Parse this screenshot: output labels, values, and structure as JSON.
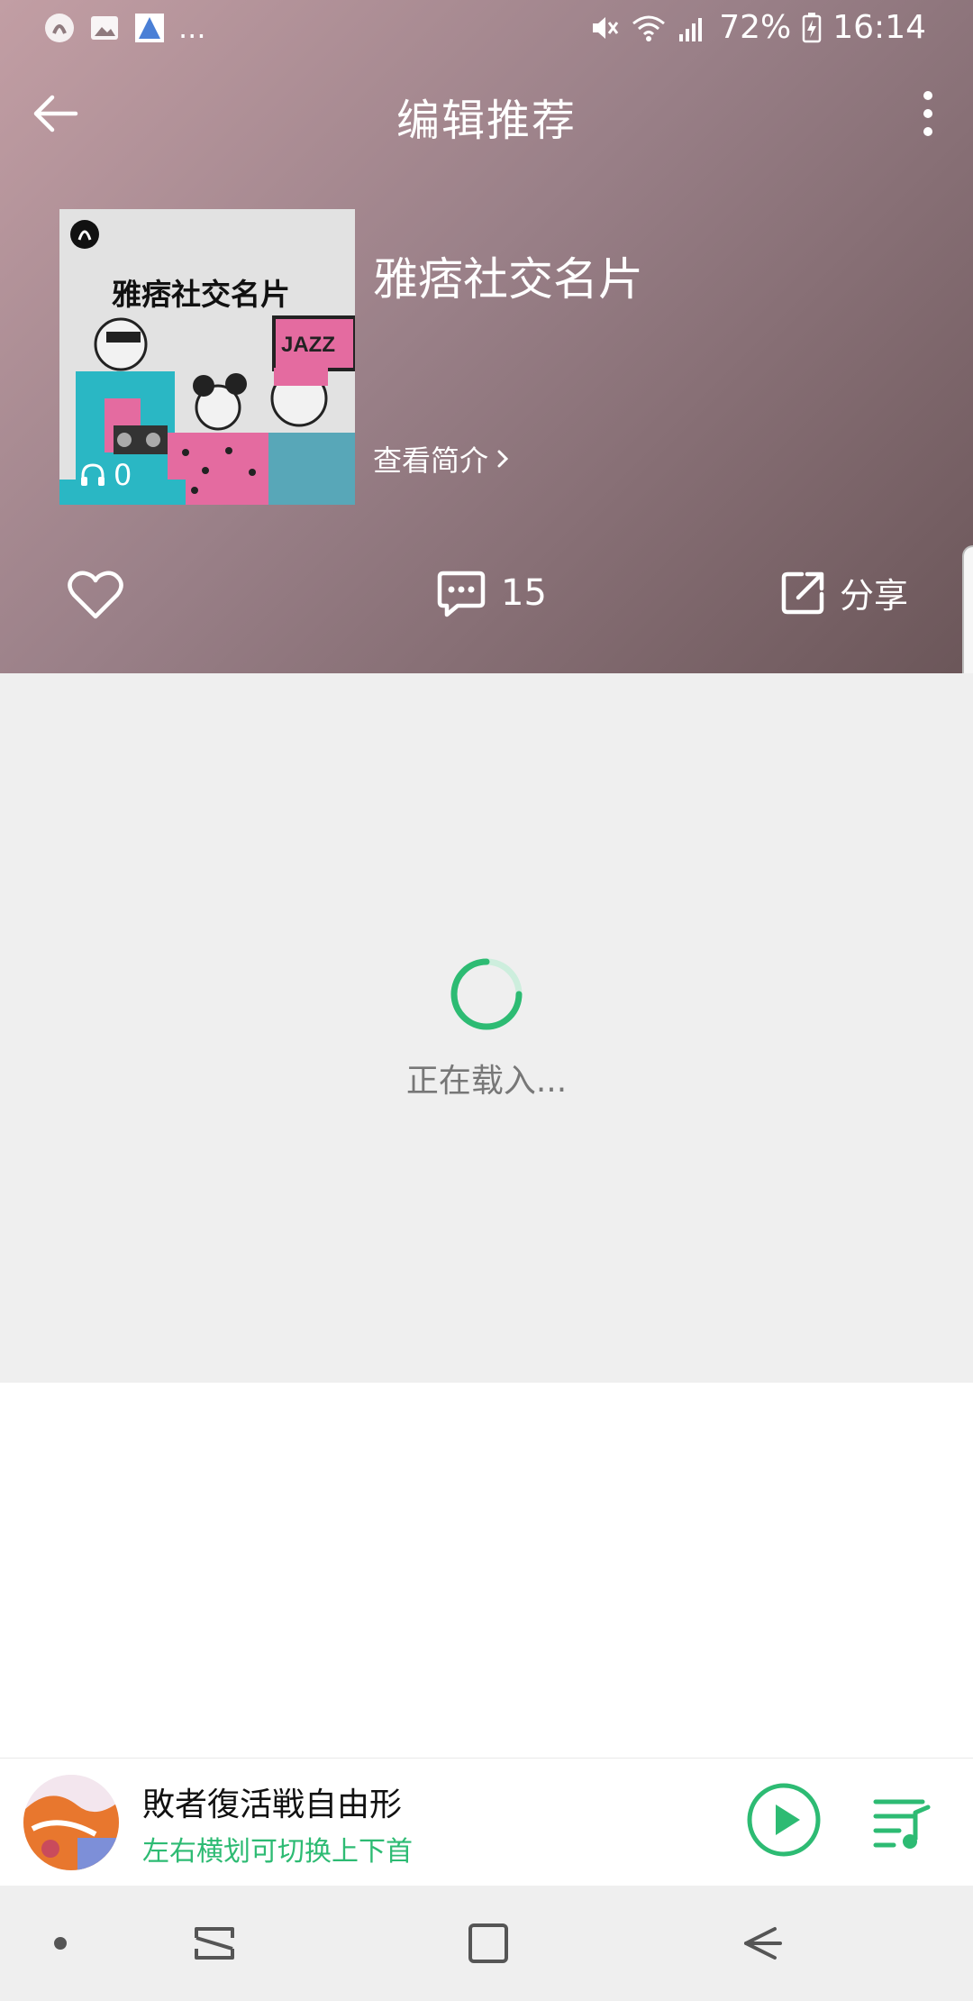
{
  "status_bar": {
    "battery": "72%",
    "time": "16:14",
    "overflow": "...",
    "icons": [
      "notification-icon",
      "gallery-icon",
      "app-icon",
      "mute-icon",
      "wifi-icon",
      "signal-icon",
      "battery-charging-icon"
    ]
  },
  "app_bar": {
    "title": "编辑推荐"
  },
  "playlist": {
    "cover_text": "雅痞社交名片",
    "cover_sign": "JAZZ",
    "play_count": "0",
    "title": "雅痞社交名片",
    "view_intro": "查看简介"
  },
  "actions": {
    "comment_count": "15",
    "share_label": "分享"
  },
  "loading": {
    "text": "正在载入..."
  },
  "player": {
    "song": "敗者復活戦自由形",
    "hint": "左右横划可切换上下首"
  },
  "colors": {
    "accent": "#2dbb73",
    "header_start": "#c29ea4",
    "header_end": "#6b5659",
    "loading_bg": "#efefef"
  }
}
